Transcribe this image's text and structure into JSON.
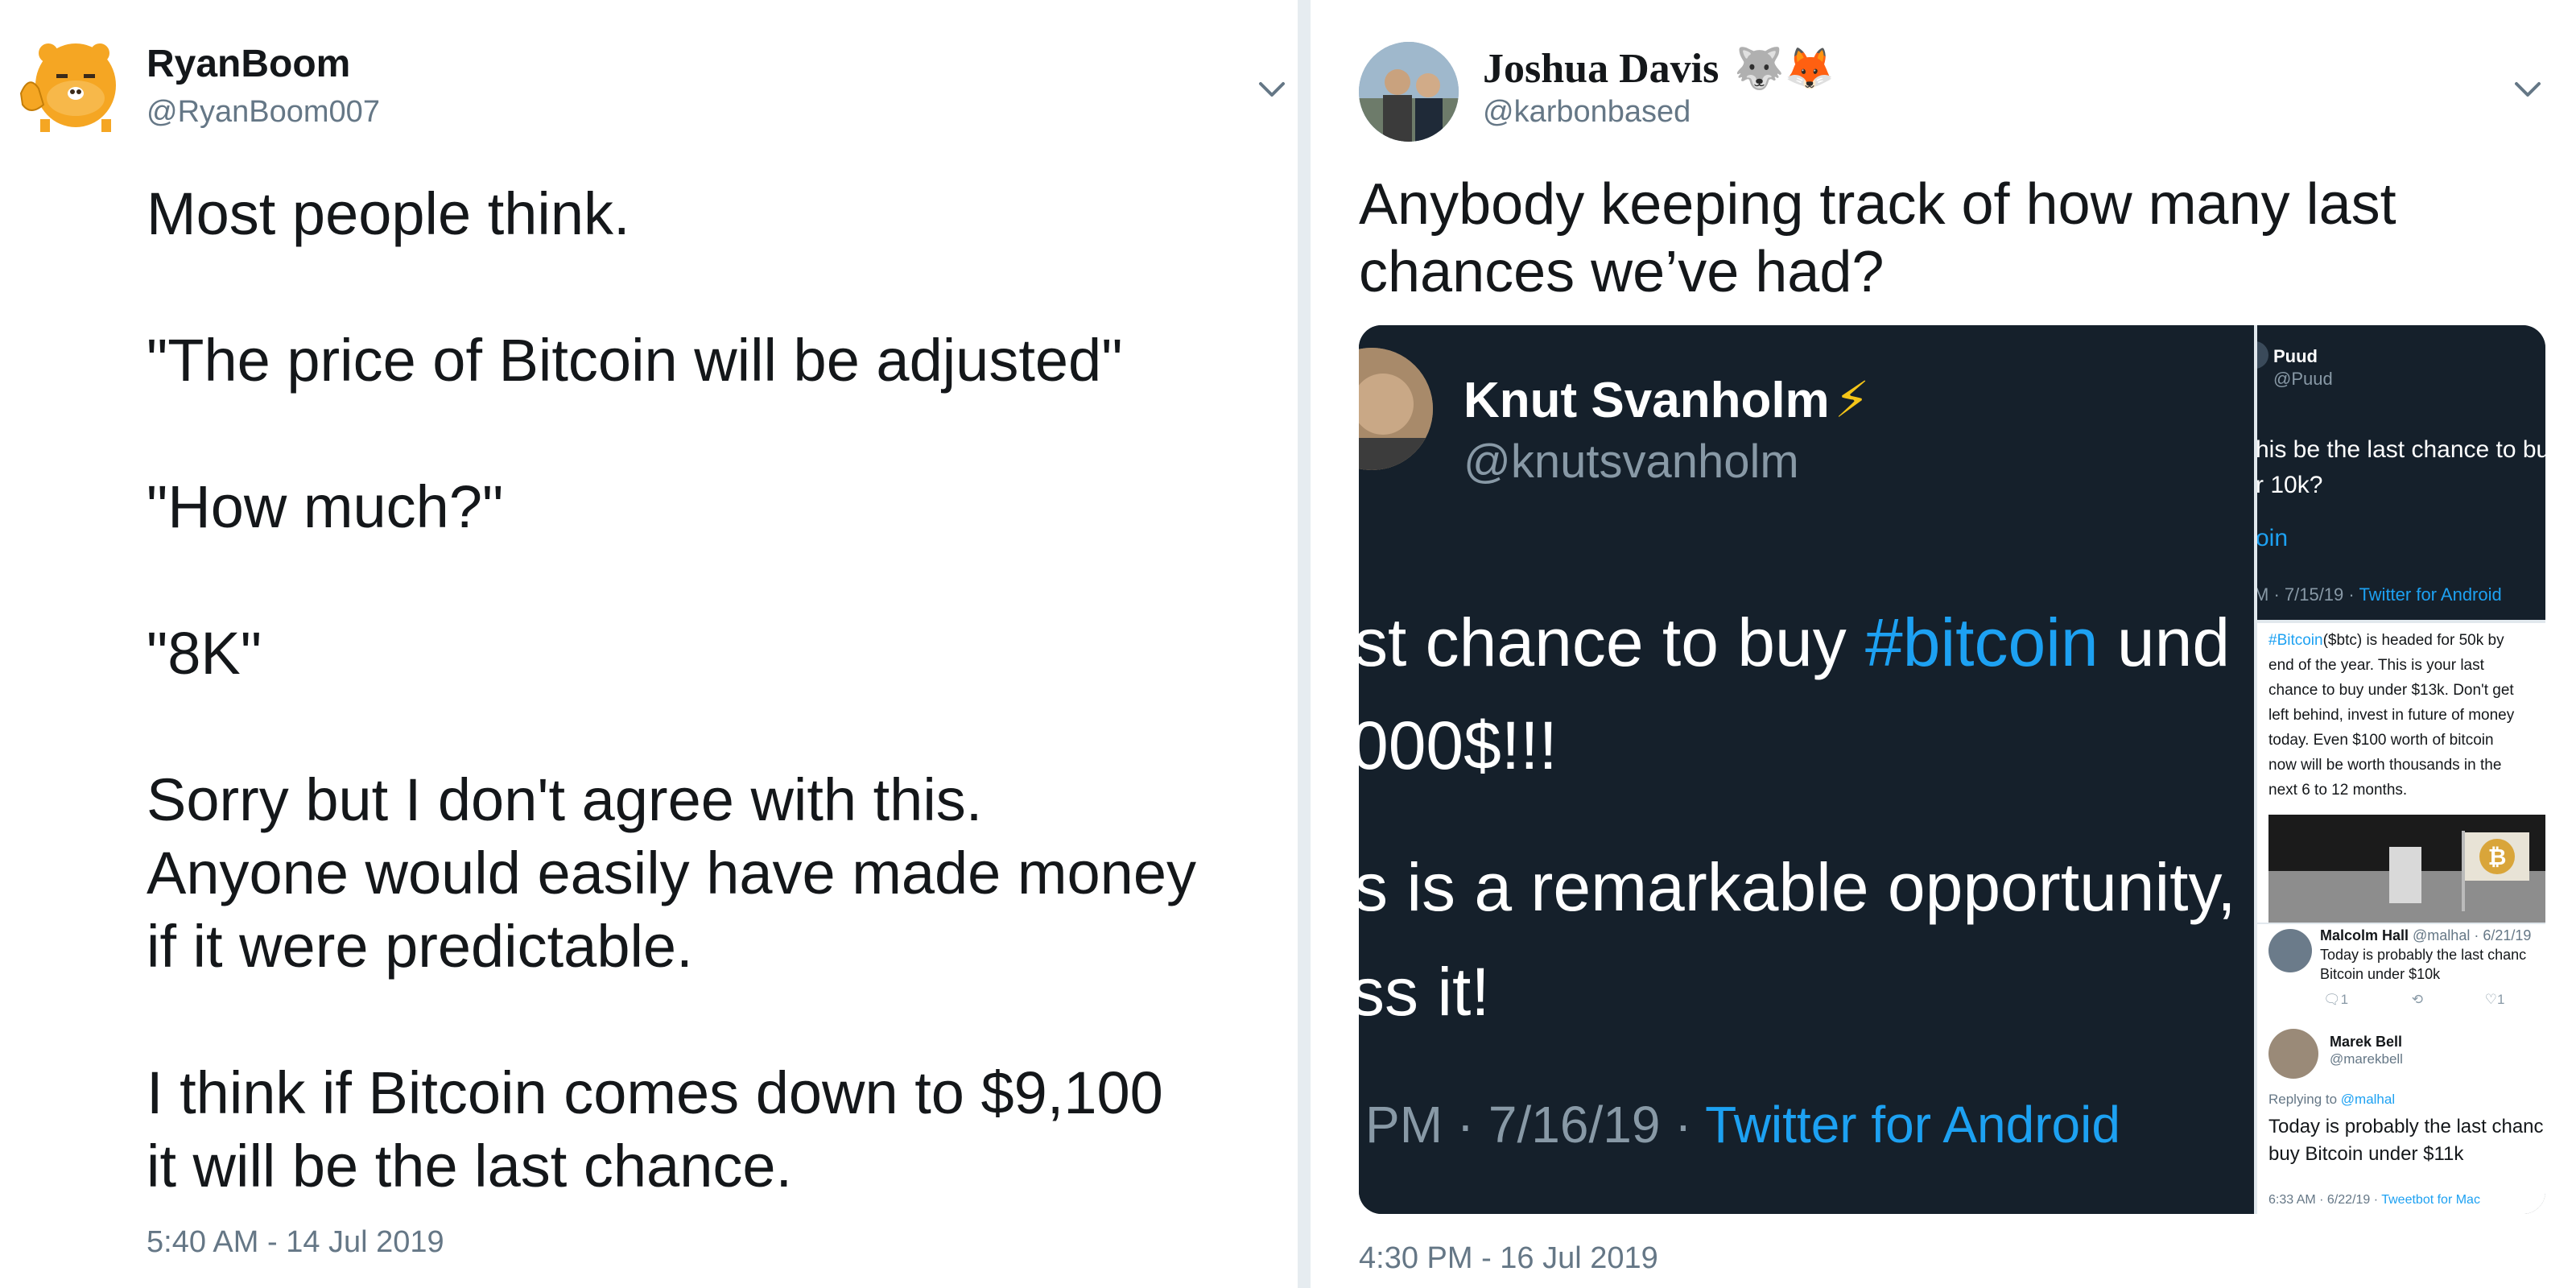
{
  "left_tweet": {
    "name": "RyanBoom",
    "handle": "@RyanBoom007",
    "text": "Most people think.\n\n\"The price of Bitcoin will be adjusted\"\n\n\"How much?\"\n\n\"8K\"\n\nSorry but I don't agree with this.\nAnyone would easily have made money\nif it were predictable.\n\nI think if Bitcoin comes down to $9,100\nit will be the last chance.",
    "timestamp": "5:40 AM - 14 Jul 2019",
    "avatar_icon": "ryan-character-icon"
  },
  "right_tweet": {
    "name": "Joshua Davis",
    "emoji": "🐺🦊",
    "handle": "@karbonbased",
    "text": "Anybody keeping track of how many last\nchances we’ve had?",
    "timestamp": "4:30 PM - 16 Jul 2019",
    "embed": {
      "main": {
        "name": "Knut Svanholm",
        "bolt": "⚡",
        "handle": "@knutsvanholm",
        "line1_a": "st chance to buy ",
        "line1_hashtag": "#bitcoin",
        "line1_b": " und",
        "line2": "000$!!!",
        "line3": "s is a remarkable opportunity,",
        "line4": "ss it!",
        "footer_time": "PM · 7/16/19 · ",
        "footer_source": "Twitter for Android"
      },
      "side_top": {
        "name": "Puud",
        "handle": "@Puud",
        "line1": "his be the last chance to bu",
        "line2": "r 10k?",
        "link": "oin",
        "footer_time": "M · 7/15/19 · ",
        "footer_source": "Twitter for Android"
      },
      "side_mid": {
        "hashtag": "#Bitcoin",
        "lines": [
          "($btc) is headed for 50k by",
          "end of the year.  This is your last",
          "chance to buy under $13k.  Don't get",
          "left behind, invest in future of money",
          "today.  Even $100 worth of bitcoin",
          "now will be worth thousands in the",
          "next 6 to 12 months."
        ]
      },
      "side_reply1": {
        "name": "Malcolm Hall",
        "meta": " @malhal · 6/21/19",
        "line1": "Today is probably the last chanc",
        "line2": "Bitcoin under $10k",
        "reply_count": "1",
        "like_count": "1"
      },
      "side_reply2": {
        "name": "Marek Bell",
        "handle": "@marekbell",
        "replying": "Replying to ",
        "replying_to": "@malhal",
        "line1": "Today is probably the last chanc",
        "line2": "buy Bitcoin under $11k",
        "footer_time": "6:33 AM · 6/22/19 · ",
        "footer_source": "Tweetbot for Mac"
      }
    }
  },
  "colors": {
    "name": "#14171a",
    "muted": "#657786",
    "link": "#1da1f2",
    "embed_bg": "#15202b"
  }
}
